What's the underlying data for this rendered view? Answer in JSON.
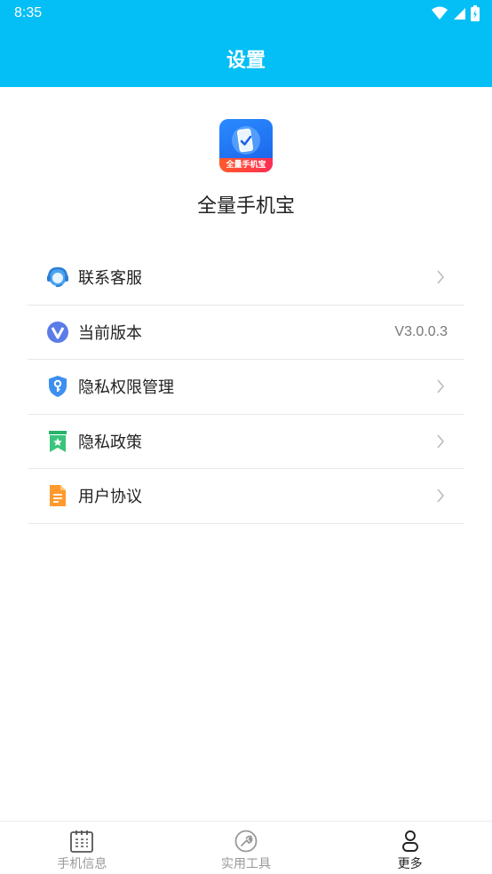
{
  "status_bar": {
    "time": "8:35",
    "icons": [
      "wifi-icon",
      "signal-icon",
      "battery-icon"
    ]
  },
  "header": {
    "title": "设置"
  },
  "app": {
    "name": "全量手机宝",
    "logo_text": "全量手机宝"
  },
  "menu": [
    {
      "label": "联系客服",
      "icon": "customer-service-icon"
    },
    {
      "label": "当前版本",
      "icon": "version-icon",
      "value": "V3.0.0.3"
    },
    {
      "label": "隐私权限管理",
      "icon": "privacy-shield-icon"
    },
    {
      "label": "隐私政策",
      "icon": "policy-bookmark-icon"
    },
    {
      "label": "用户协议",
      "icon": "agreement-document-icon"
    }
  ],
  "bottom_nav": [
    {
      "label": "手机信息",
      "icon": "calendar-icon",
      "active": false
    },
    {
      "label": "实用工具",
      "icon": "wrench-icon",
      "active": false
    },
    {
      "label": "更多",
      "icon": "person-icon",
      "active": true
    }
  ],
  "colors": {
    "primary": "#04bff5",
    "active_text": "#222222",
    "inactive_text": "#999999"
  }
}
